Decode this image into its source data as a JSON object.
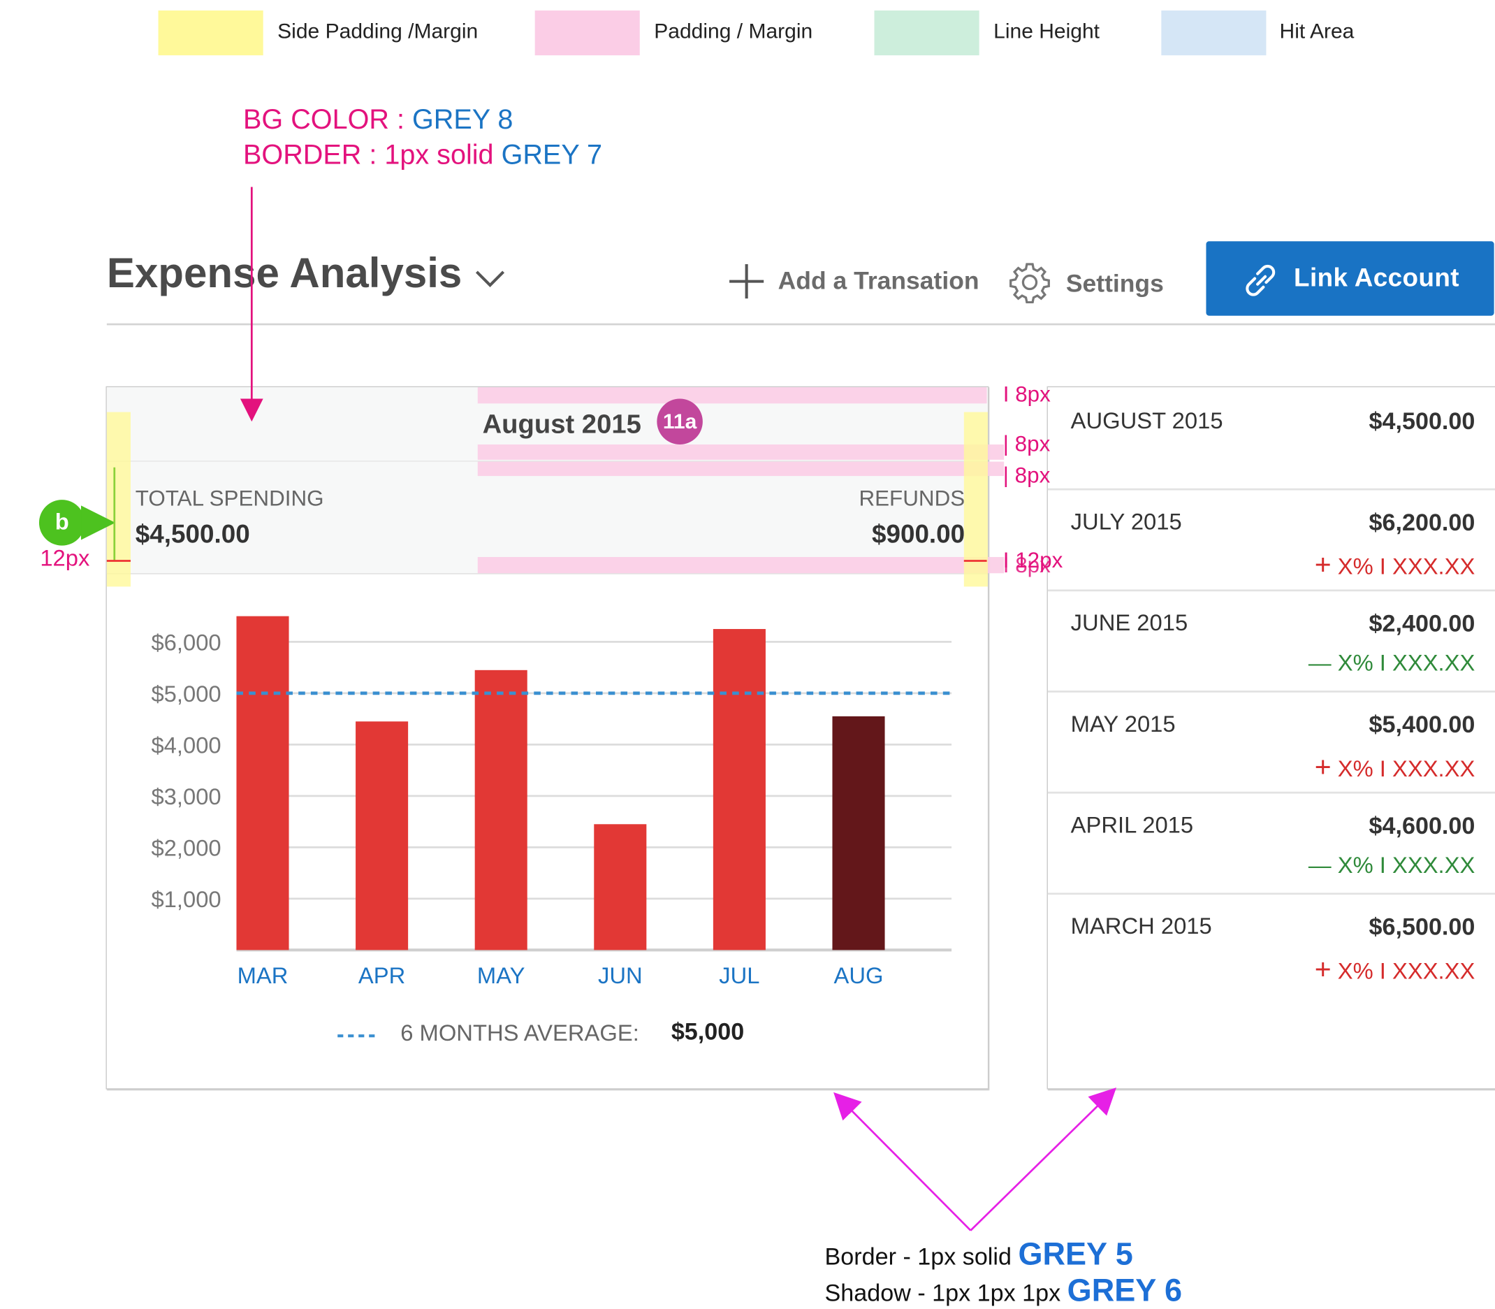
{
  "legend": [
    {
      "label": "Side Padding /Margin",
      "color": "#fff99a"
    },
    {
      "label": "Padding / Margin",
      "color": "#fbcde6"
    },
    {
      "label": "Line Height",
      "color": "#cdeedc"
    },
    {
      "label": "Hit Area",
      "color": "#d5e6f6"
    }
  ],
  "annotations": {
    "bg_color_label": "BG COLOR :",
    "bg_color_value": "GREY 8",
    "border_label": "BORDER : 1px solid",
    "border_value": "GREY 7",
    "spacing": [
      "8px",
      "8px",
      "8px",
      "12px",
      "8px"
    ],
    "left_spacing": "12px",
    "badge_b": "b",
    "badge_11a": "11a",
    "card_border_label": "Border  - 1px solid",
    "card_border_value": "GREY 5",
    "card_shadow_label": "Shadow  - 1px 1px 1px",
    "card_shadow_value": "GREY 6"
  },
  "header": {
    "title": "Expense Analysis",
    "add_label": "Add a Transation",
    "settings_label": "Settings",
    "link_label": "Link Account"
  },
  "summary": {
    "month": "August 2015",
    "total_label": "TOTAL SPENDING",
    "total_value": "$4,500.00",
    "refunds_label": "REFUNDS",
    "refunds_value": "$900.00"
  },
  "chart_data": {
    "type": "bar",
    "categories": [
      "MAR",
      "APR",
      "MAY",
      "JUN",
      "JUL",
      "AUG"
    ],
    "values": [
      6500,
      4450,
      5450,
      2450,
      6250,
      4550
    ],
    "y_ticks": [
      1000,
      2000,
      3000,
      4000,
      5000,
      6000
    ],
    "y_tick_labels": [
      "$1,000",
      "$2,000",
      "$3,000",
      "$4,000",
      "$5,000",
      "$6,000"
    ],
    "ylim": [
      0,
      6500
    ],
    "average": 5000,
    "average_label": "6 MONTHS AVERAGE:",
    "average_value": "$5,000",
    "bar_color": "#e23835",
    "highlight_color": "#63171a",
    "highlight_index": 5,
    "average_color": "#3a8fd0",
    "grid": true
  },
  "history": [
    {
      "month": "AUGUST 2015",
      "amount": "$4,500.00",
      "sign": "",
      "change": "",
      "trend": "none"
    },
    {
      "month": "JULY 2015",
      "amount": "$6,200.00",
      "sign": "+",
      "change": "X%  I  XXX.XX",
      "trend": "up"
    },
    {
      "month": "JUNE 2015",
      "amount": "$2,400.00",
      "sign": "—",
      "change": "X%  I  XXX.XX",
      "trend": "down"
    },
    {
      "month": "MAY 2015",
      "amount": "$5,400.00",
      "sign": "+",
      "change": "X%  I  XXX.XX",
      "trend": "up"
    },
    {
      "month": "APRIL 2015",
      "amount": "$4,600.00",
      "sign": "—",
      "change": "X%  I  XXX.XX",
      "trend": "down"
    },
    {
      "month": "MARCH 2015",
      "amount": "$6,500.00",
      "sign": "+",
      "change": "X%  I  XXX.XX",
      "trend": "up"
    }
  ]
}
